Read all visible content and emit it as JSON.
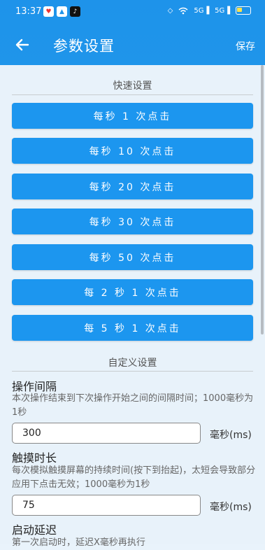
{
  "status_bar": {
    "time": "13:37",
    "network_1": "5G",
    "network_2": "5G"
  },
  "header": {
    "title": "参数设置",
    "save_label": "保存",
    "accent_color": "#1e93ea"
  },
  "quick": {
    "section_title": "快速设置",
    "buttons": [
      "每秒 1 次点击",
      "每秒 10 次点击",
      "每秒 20 次点击",
      "每秒 30 次点击",
      "每秒 50 次点击",
      "每 2 秒 1 次点击",
      "每 5 秒 1 次点击"
    ],
    "button_color": "#1c96ef"
  },
  "custom": {
    "section_title": "自定义设置",
    "interval": {
      "label": "操作间隔",
      "description": "本次操作结束到下次操作开始之间的间隔时间；1000毫秒为1秒",
      "value": "300",
      "unit": "毫秒(ms)"
    },
    "duration": {
      "label": "触摸时长",
      "description": "每次模拟触摸屏幕的持续时间(按下到抬起)，太短会导致部分应用下点击无效；1000毫秒为1秒",
      "value": "75",
      "unit": "毫秒(ms)"
    },
    "delay": {
      "label": "启动延迟",
      "description": "第一次启动时，延迟X毫秒再执行"
    }
  }
}
